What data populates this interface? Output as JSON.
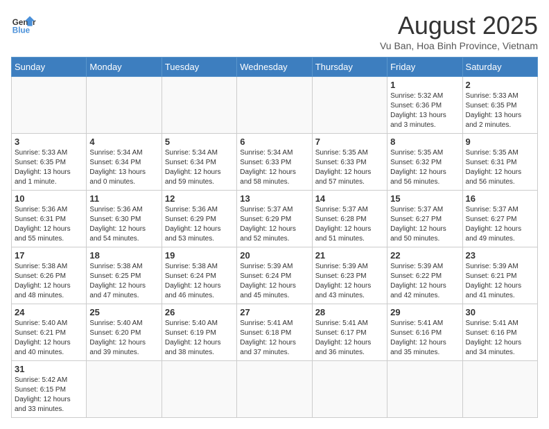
{
  "header": {
    "logo_general": "General",
    "logo_blue": "Blue",
    "month_title": "August 2025",
    "subtitle": "Vu Ban, Hoa Binh Province, Vietnam"
  },
  "days_of_week": [
    "Sunday",
    "Monday",
    "Tuesday",
    "Wednesday",
    "Thursday",
    "Friday",
    "Saturday"
  ],
  "weeks": [
    [
      {
        "day": "",
        "info": ""
      },
      {
        "day": "",
        "info": ""
      },
      {
        "day": "",
        "info": ""
      },
      {
        "day": "",
        "info": ""
      },
      {
        "day": "",
        "info": ""
      },
      {
        "day": "1",
        "info": "Sunrise: 5:32 AM\nSunset: 6:36 PM\nDaylight: 13 hours\nand 3 minutes."
      },
      {
        "day": "2",
        "info": "Sunrise: 5:33 AM\nSunset: 6:35 PM\nDaylight: 13 hours\nand 2 minutes."
      }
    ],
    [
      {
        "day": "3",
        "info": "Sunrise: 5:33 AM\nSunset: 6:35 PM\nDaylight: 13 hours\nand 1 minute."
      },
      {
        "day": "4",
        "info": "Sunrise: 5:34 AM\nSunset: 6:34 PM\nDaylight: 13 hours\nand 0 minutes."
      },
      {
        "day": "5",
        "info": "Sunrise: 5:34 AM\nSunset: 6:34 PM\nDaylight: 12 hours\nand 59 minutes."
      },
      {
        "day": "6",
        "info": "Sunrise: 5:34 AM\nSunset: 6:33 PM\nDaylight: 12 hours\nand 58 minutes."
      },
      {
        "day": "7",
        "info": "Sunrise: 5:35 AM\nSunset: 6:33 PM\nDaylight: 12 hours\nand 57 minutes."
      },
      {
        "day": "8",
        "info": "Sunrise: 5:35 AM\nSunset: 6:32 PM\nDaylight: 12 hours\nand 56 minutes."
      },
      {
        "day": "9",
        "info": "Sunrise: 5:35 AM\nSunset: 6:31 PM\nDaylight: 12 hours\nand 56 minutes."
      }
    ],
    [
      {
        "day": "10",
        "info": "Sunrise: 5:36 AM\nSunset: 6:31 PM\nDaylight: 12 hours\nand 55 minutes."
      },
      {
        "day": "11",
        "info": "Sunrise: 5:36 AM\nSunset: 6:30 PM\nDaylight: 12 hours\nand 54 minutes."
      },
      {
        "day": "12",
        "info": "Sunrise: 5:36 AM\nSunset: 6:29 PM\nDaylight: 12 hours\nand 53 minutes."
      },
      {
        "day": "13",
        "info": "Sunrise: 5:37 AM\nSunset: 6:29 PM\nDaylight: 12 hours\nand 52 minutes."
      },
      {
        "day": "14",
        "info": "Sunrise: 5:37 AM\nSunset: 6:28 PM\nDaylight: 12 hours\nand 51 minutes."
      },
      {
        "day": "15",
        "info": "Sunrise: 5:37 AM\nSunset: 6:27 PM\nDaylight: 12 hours\nand 50 minutes."
      },
      {
        "day": "16",
        "info": "Sunrise: 5:37 AM\nSunset: 6:27 PM\nDaylight: 12 hours\nand 49 minutes."
      }
    ],
    [
      {
        "day": "17",
        "info": "Sunrise: 5:38 AM\nSunset: 6:26 PM\nDaylight: 12 hours\nand 48 minutes."
      },
      {
        "day": "18",
        "info": "Sunrise: 5:38 AM\nSunset: 6:25 PM\nDaylight: 12 hours\nand 47 minutes."
      },
      {
        "day": "19",
        "info": "Sunrise: 5:38 AM\nSunset: 6:24 PM\nDaylight: 12 hours\nand 46 minutes."
      },
      {
        "day": "20",
        "info": "Sunrise: 5:39 AM\nSunset: 6:24 PM\nDaylight: 12 hours\nand 45 minutes."
      },
      {
        "day": "21",
        "info": "Sunrise: 5:39 AM\nSunset: 6:23 PM\nDaylight: 12 hours\nand 43 minutes."
      },
      {
        "day": "22",
        "info": "Sunrise: 5:39 AM\nSunset: 6:22 PM\nDaylight: 12 hours\nand 42 minutes."
      },
      {
        "day": "23",
        "info": "Sunrise: 5:39 AM\nSunset: 6:21 PM\nDaylight: 12 hours\nand 41 minutes."
      }
    ],
    [
      {
        "day": "24",
        "info": "Sunrise: 5:40 AM\nSunset: 6:21 PM\nDaylight: 12 hours\nand 40 minutes."
      },
      {
        "day": "25",
        "info": "Sunrise: 5:40 AM\nSunset: 6:20 PM\nDaylight: 12 hours\nand 39 minutes."
      },
      {
        "day": "26",
        "info": "Sunrise: 5:40 AM\nSunset: 6:19 PM\nDaylight: 12 hours\nand 38 minutes."
      },
      {
        "day": "27",
        "info": "Sunrise: 5:41 AM\nSunset: 6:18 PM\nDaylight: 12 hours\nand 37 minutes."
      },
      {
        "day": "28",
        "info": "Sunrise: 5:41 AM\nSunset: 6:17 PM\nDaylight: 12 hours\nand 36 minutes."
      },
      {
        "day": "29",
        "info": "Sunrise: 5:41 AM\nSunset: 6:16 PM\nDaylight: 12 hours\nand 35 minutes."
      },
      {
        "day": "30",
        "info": "Sunrise: 5:41 AM\nSunset: 6:16 PM\nDaylight: 12 hours\nand 34 minutes."
      }
    ],
    [
      {
        "day": "31",
        "info": "Sunrise: 5:42 AM\nSunset: 6:15 PM\nDaylight: 12 hours\nand 33 minutes."
      },
      {
        "day": "",
        "info": ""
      },
      {
        "day": "",
        "info": ""
      },
      {
        "day": "",
        "info": ""
      },
      {
        "day": "",
        "info": ""
      },
      {
        "day": "",
        "info": ""
      },
      {
        "day": "",
        "info": ""
      }
    ]
  ]
}
